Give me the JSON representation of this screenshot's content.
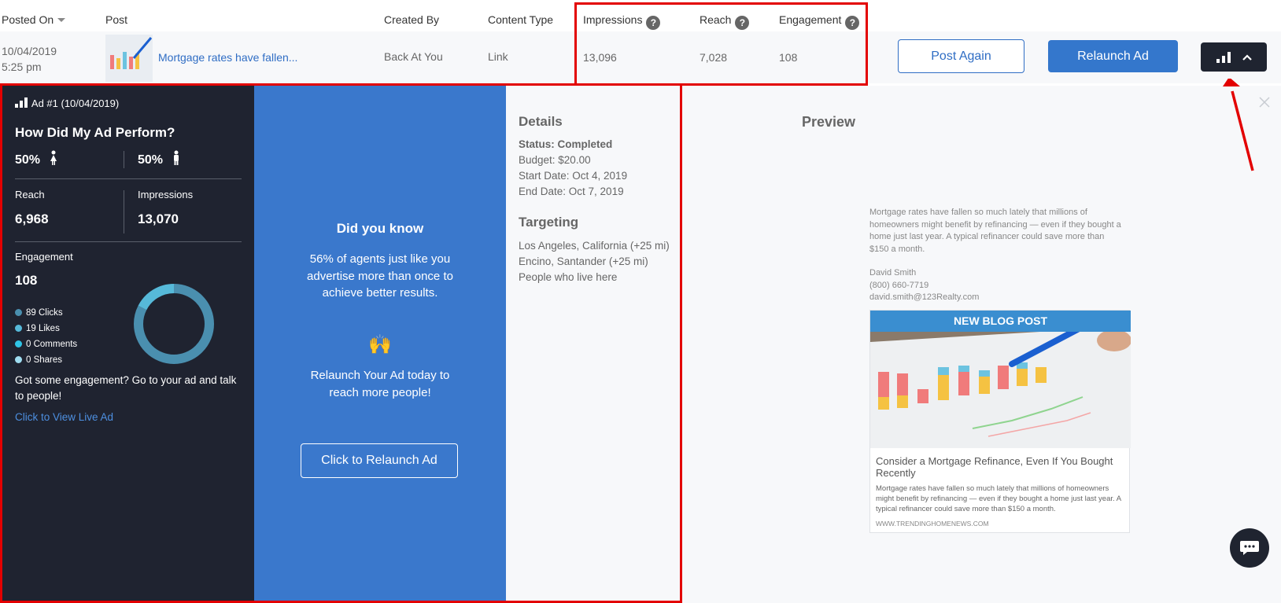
{
  "table_header": {
    "posted_on": "Posted On",
    "post": "Post",
    "created_by": "Created By",
    "content_type": "Content Type",
    "impressions": "Impressions",
    "reach": "Reach",
    "engagement": "Engagement",
    "help_glyph": "?"
  },
  "row": {
    "date": "10/04/2019",
    "time": "5:25 pm",
    "post_title": "Mortgage rates have fallen...",
    "created_by": "Back At You",
    "content_type": "Link",
    "impressions": "13,096",
    "reach": "7,028",
    "engagement": "108",
    "post_again_label": "Post Again",
    "relaunch_label": "Relaunch Ad"
  },
  "stats": {
    "ad_label": "Ad #1 (10/04/2019)",
    "heading": "How Did My Ad Perform?",
    "female_pct": "50%",
    "male_pct": "50%",
    "reach_label": "Reach",
    "reach_value": "6,968",
    "impressions_label": "Impressions",
    "impressions_value": "13,070",
    "engagement_label": "Engagement",
    "engagement_value": "108",
    "breakdown": [
      {
        "label": "89 Clicks",
        "color": "#4a8faf"
      },
      {
        "label": "19 Likes",
        "color": "#56b9d9"
      },
      {
        "label": "0 Comments",
        "color": "#2fc4e6"
      },
      {
        "label": "0 Shares",
        "color": "#9fdcf0"
      }
    ],
    "cta_text_line1": "Got some engagement? Go to your ad and talk",
    "cta_text_line2": "to people!",
    "view_live_label": "Click to View Live Ad"
  },
  "promo": {
    "heading": "Did you know",
    "line1": "56% of agents just like you",
    "line2": "advertise more than once to",
    "line3": "achieve better results.",
    "emoji": "🙌",
    "line4": "Relaunch Your Ad today to",
    "line5": "reach more people!",
    "button_label": "Click to Relaunch Ad"
  },
  "details": {
    "heading": "Details",
    "status": "Status: Completed",
    "budget": "Budget: $20.00",
    "start": "Start Date: Oct 4, 2019",
    "end": "End Date: Oct 7, 2019",
    "targeting_heading": "Targeting",
    "targets": [
      "Los Angeles, California (+25 mi)",
      "Encino, Santander (+25 mi)",
      "People who live here"
    ]
  },
  "preview": {
    "heading": "Preview",
    "body_lines": [
      "Mortgage rates have fallen so much lately that millions of",
      "homeowners might benefit by refinancing — even if they bought a",
      "home just last year. A typical refinancer could save more than",
      "$150 a month."
    ],
    "contact": [
      "David Smith",
      "(800) 660-7719",
      "david.smith@123Realty.com"
    ],
    "banner": "NEW BLOG POST",
    "card_title": "Consider a Mortgage Refinance, Even If You Bought Recently",
    "card_desc": "Mortgage rates have fallen so much lately that millions of homeowners might benefit by refinancing — even if they bought a home just last year. A typical refinancer could save more than $150 a month.",
    "card_url": "WWW.TRENDINGHOMENEWS.COM"
  },
  "colors": {
    "accent_blue": "#3477cc",
    "dark_panel": "#1f2330",
    "highlight_red": "#e30000"
  },
  "engagement_chart": {
    "clicks": 89,
    "likes": 19,
    "comments": 0,
    "shares": 0
  }
}
